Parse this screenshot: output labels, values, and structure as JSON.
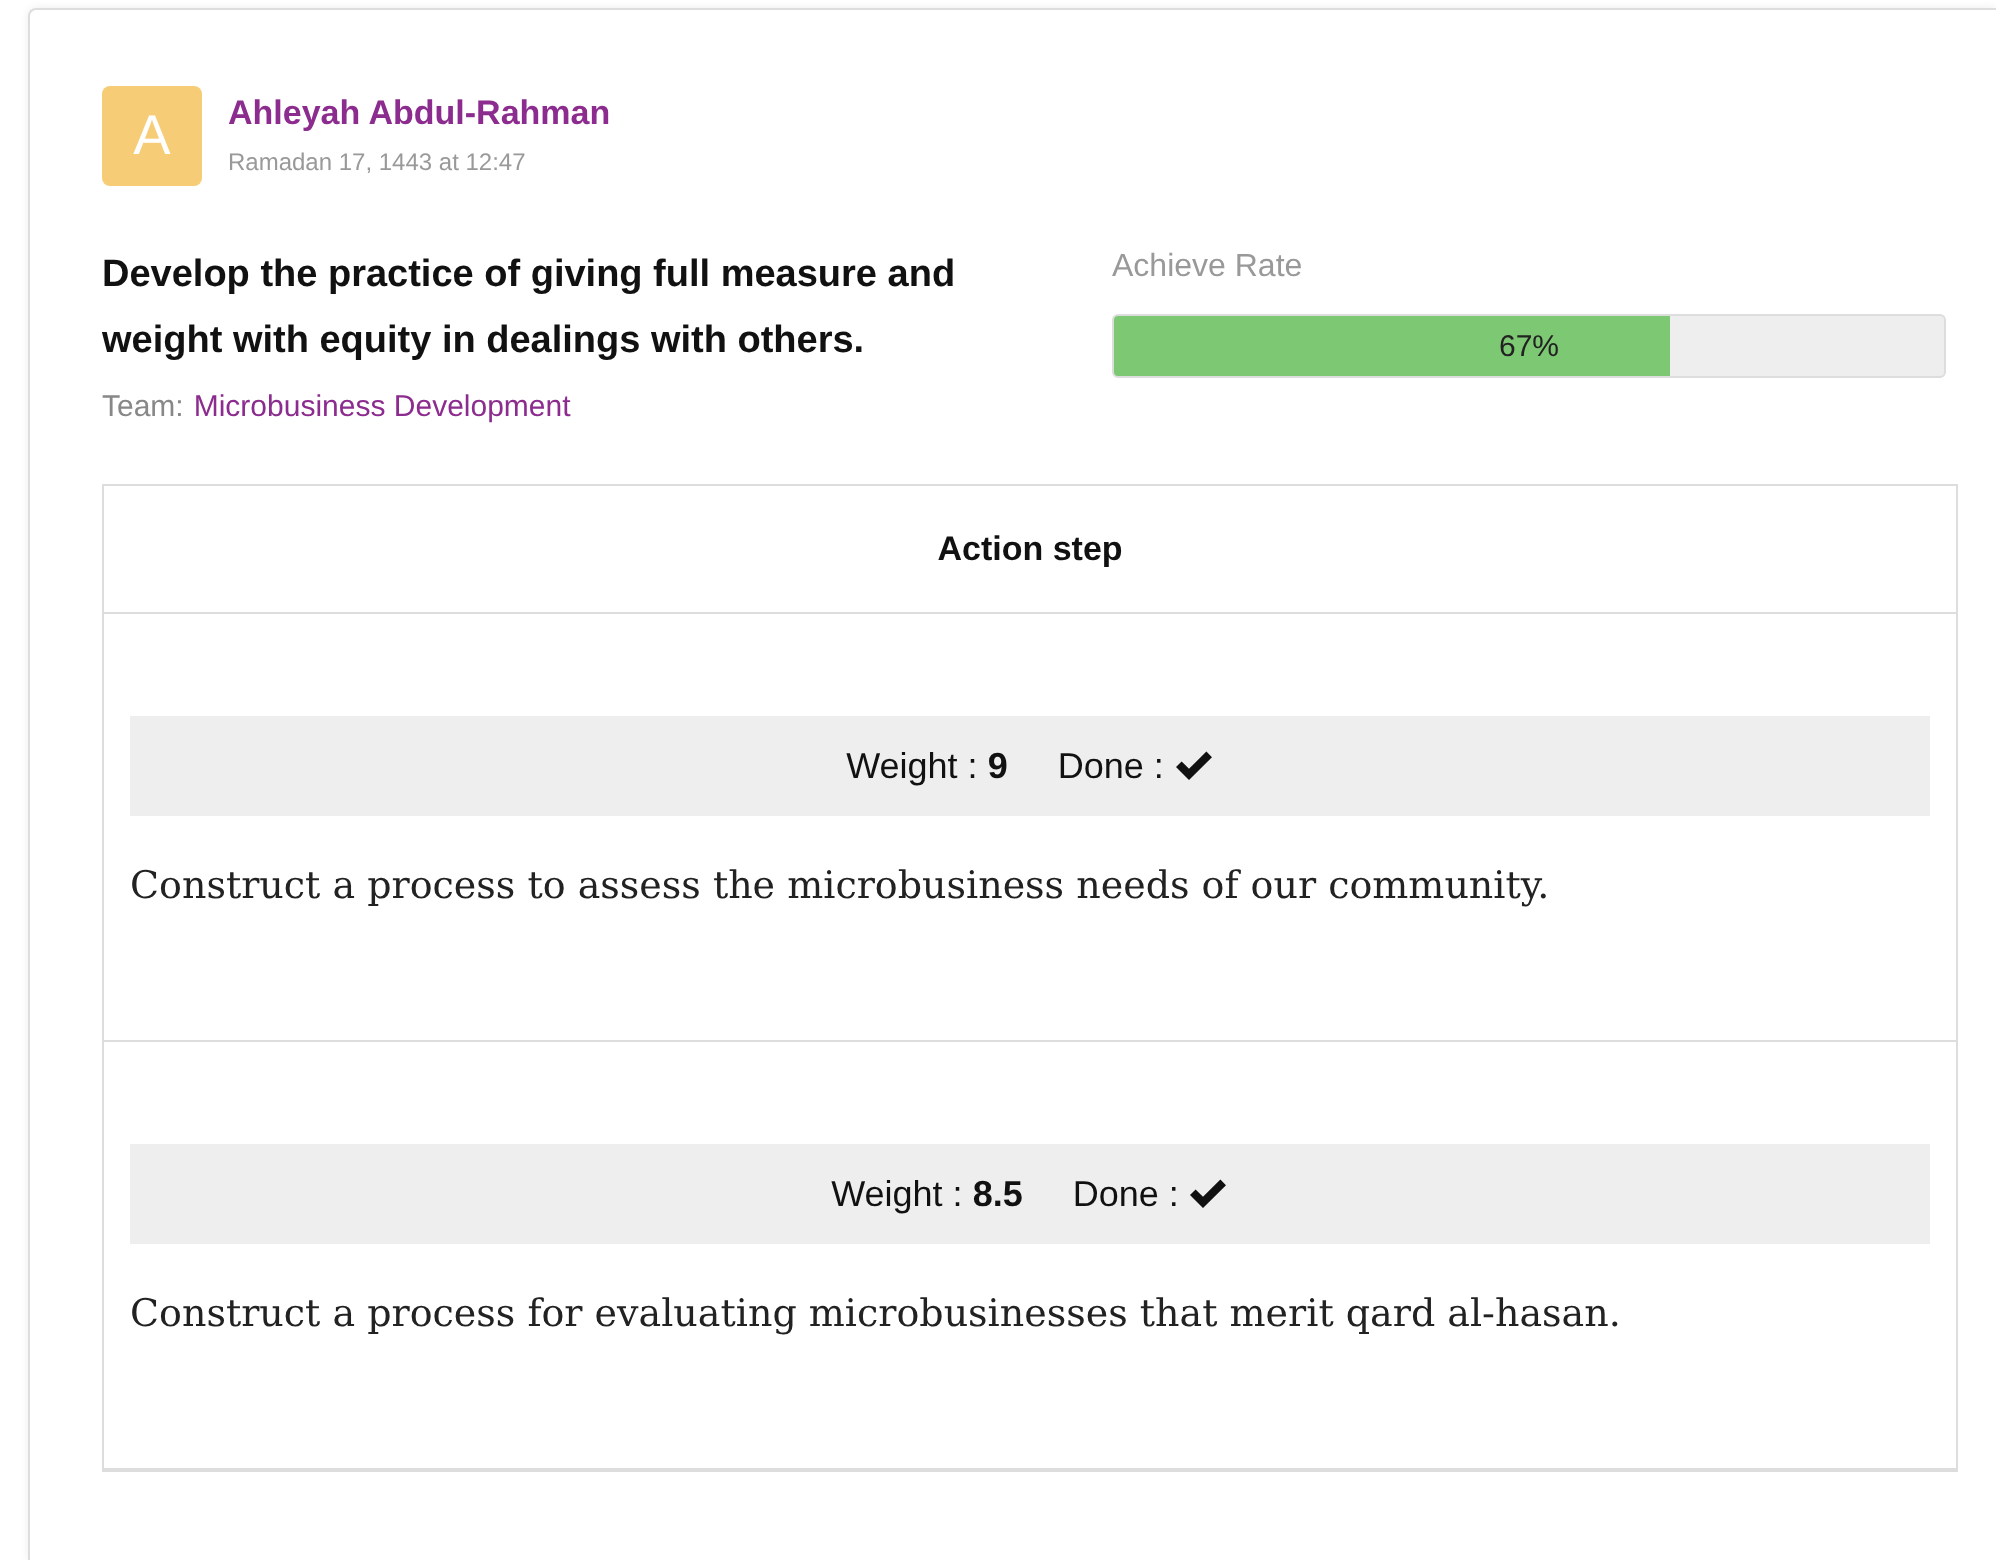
{
  "author": {
    "initial": "A",
    "name": "Ahleyah Abdul-Rahman",
    "date": "Ramadan 17, 1443 at 12:47"
  },
  "goal": {
    "title": "Develop the practice of giving full measure and weight with equity in dealings with others.",
    "team_label": "Team:",
    "team": "Microbusiness Development"
  },
  "achieve": {
    "label": "Achieve Rate",
    "level": 0.67,
    "reading": "67%"
  },
  "table": {
    "header": "Action step",
    "rows": [
      {
        "weight_label": "Weight :",
        "weight": "9",
        "done_label": "Done :",
        "done": true,
        "text": "Construct a process to assess the microbusiness needs of our community."
      },
      {
        "weight_label": "Weight :",
        "weight": "8.5",
        "done_label": "Done :",
        "done": true,
        "text": "Construct a process for evaluating microbusinesses that merit qard al-hasan."
      }
    ]
  }
}
